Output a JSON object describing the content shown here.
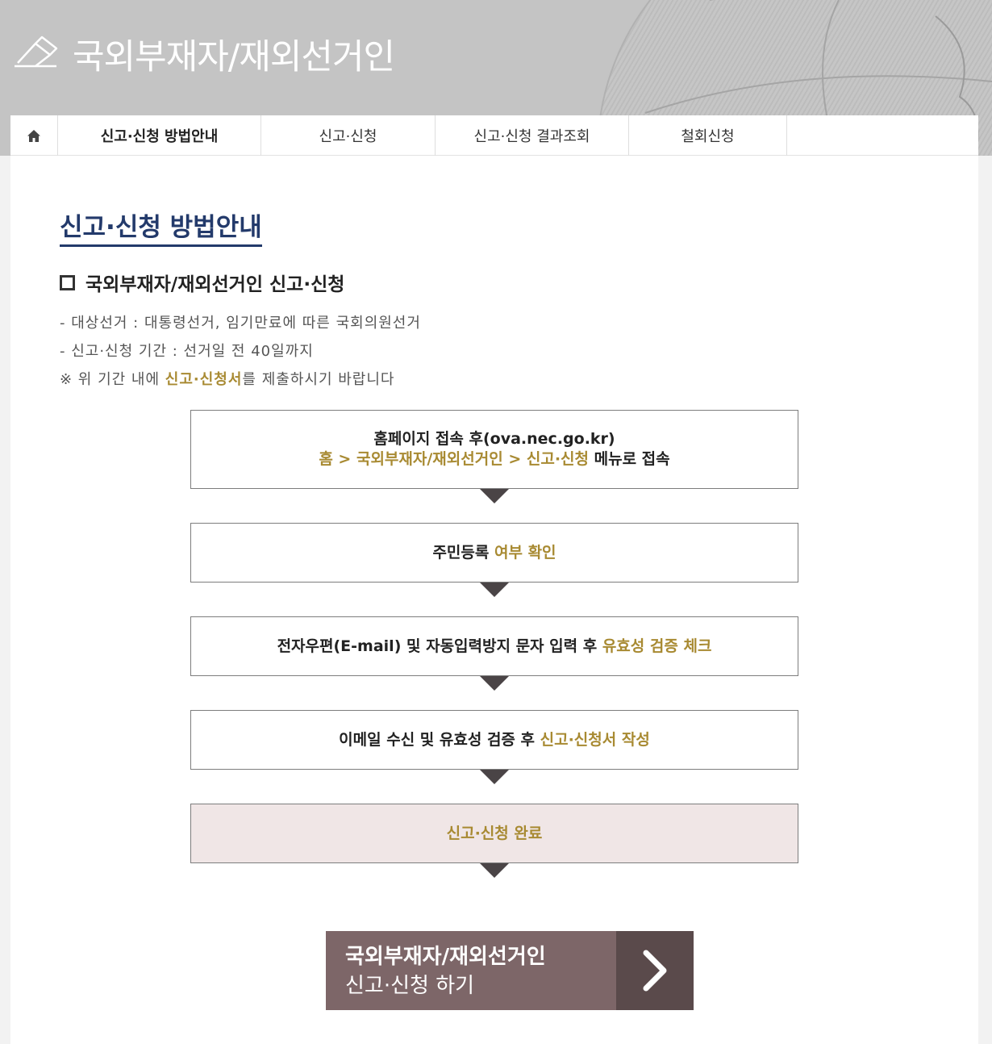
{
  "banner": {
    "title": "국외부재자/재외선거인"
  },
  "tabs": {
    "home_icon": "home-icon",
    "items": [
      {
        "label": "신고·신청 방법안내",
        "active": true
      },
      {
        "label": "신고·신청"
      },
      {
        "label": "신고·신청 결과조회"
      },
      {
        "label": "철회신청"
      }
    ]
  },
  "main": {
    "page_title": "신고·신청 방법안내",
    "section_title": "국외부재자/재외선거인 신고·신청",
    "info": {
      "line1": "- 대상선거 : 대통령선거, 임기만료에 따른 국회의원선거",
      "line2": "- 신고·신청 기간 : 선거일 전 40일까지",
      "line3_prefix": "※ 위 기간 내에 ",
      "line3_highlight": "신고·신청서",
      "line3_suffix": "를 제출하시기 바랍니다"
    },
    "steps": {
      "s1_line1": "홈페이지 접속 후(ova.nec.go.kr)",
      "s1_home": "홈",
      "s1_sep1": " > ",
      "s1_menu1": "국외부재자/재외선거인",
      "s1_sep2": " > ",
      "s1_menu2": "신고·신청",
      "s1_suffix": " 메뉴로 접속",
      "s2_text": "주민등록 ",
      "s2_highlight": "여부 확인",
      "s3_text": "전자우편(E-mail) 및 자동입력방지 문자 입력 후 ",
      "s3_highlight": "유효성 검증 체크",
      "s4_text": "이메일 수신 및 유효성 검증 후 ",
      "s4_highlight": "신고·신청서 작성",
      "s5_highlight": "신고·신청 완료"
    },
    "cta": {
      "line1": "국외부재자/재외선거인",
      "line2": "신고·신청 하기",
      "icon": "chevron-right-icon"
    }
  },
  "colors": {
    "accent_gold": "#a88a32",
    "title_navy": "#233a6b",
    "cta_bg": "#7d6668",
    "cta_arrow_bg": "#5a4a4b",
    "final_step_bg": "#f0e6e6"
  }
}
